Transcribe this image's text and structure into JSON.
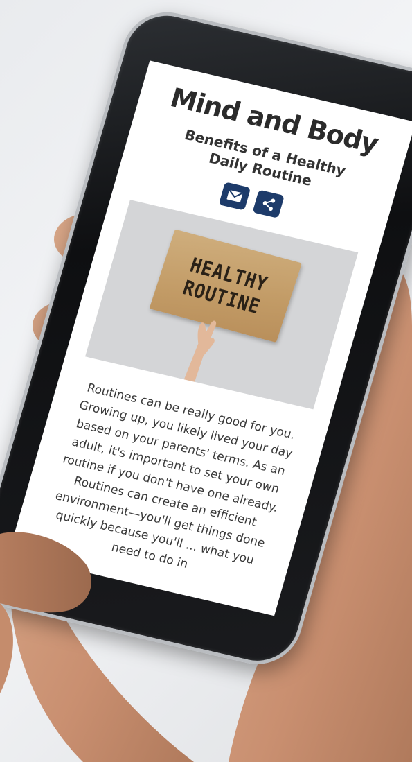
{
  "page": {
    "title": "Mind and Body",
    "subtitle": "Benefits of a Healthy Daily Routine"
  },
  "share": {
    "email_icon": "envelope-icon",
    "share_icon": "share-icon",
    "button_color": "#1d3b6a"
  },
  "hero_image": {
    "sign_line_1": "HEALTHY",
    "sign_line_2": "ROUTINE"
  },
  "article": {
    "body": "Routines can be really good for you. Growing up, you likely lived your day based on your parents' terms. As an adult, it's important to set your own routine if you don't have one already. Routines can create an efficient environment—you'll get things done quickly because you'll ... what you need to do in"
  }
}
